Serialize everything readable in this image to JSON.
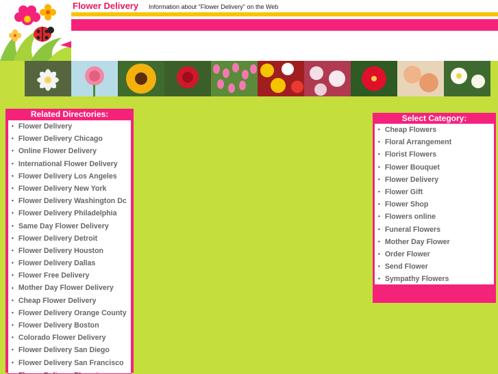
{
  "header": {
    "site_title": "Flower Delivery",
    "tagline": "Information about \"Flower Delivery\" on the Web"
  },
  "colors": {
    "pink": "#f5227a",
    "yellow": "#f7c400",
    "lime": "#c4de3c",
    "title": "#e8185a"
  },
  "left_panel": {
    "title": "Related Directories:",
    "items": [
      "Flower Delivery",
      "Flower Delivery Chicago",
      "Online Flower Delivery",
      "International Flower Delivery",
      "Flower Delivery Los Angeles",
      "Flower Delivery New York",
      "Flower Delivery Washington Dc",
      "Flower Delivery Philadelphia",
      "Same Day Flower Delivery",
      "Flower Delivery Detroit",
      "Flower Delivery Houston",
      "Flower Delivery Dallas",
      "Flower Free Delivery",
      "Mother Day Flower Delivery",
      "Cheap Flower Delivery",
      "Flower Delivery Orange County",
      "Flower Delivery Boston",
      "Colorado Flower Delivery",
      "Flower Delivery San Diego",
      "Flower Delivery San Francisco",
      "Flower Delivery Phoenix"
    ]
  },
  "right_panel": {
    "title": "Select Category:",
    "items": [
      "Cheap Flowers",
      "Floral Arrangement",
      "Florist Flowers",
      "Flower Bouquet",
      "Flower Delivery",
      "Flower Gift",
      "Flower Shop",
      "Flowers online",
      "Funeral Flowers",
      "Mother Day Flower",
      "Order Flower",
      "Send Flower",
      "Sympathy Flowers"
    ]
  }
}
